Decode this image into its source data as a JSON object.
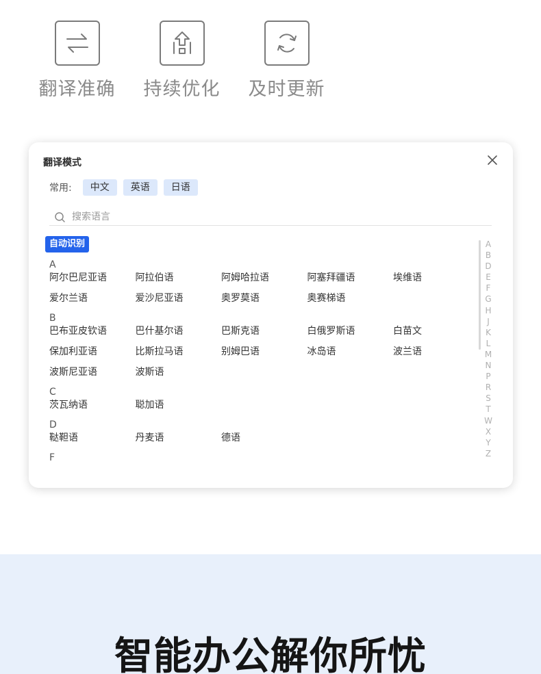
{
  "features": [
    {
      "label": "翻译准确",
      "icon": "swap-arrows-icon"
    },
    {
      "label": "持续优化",
      "icon": "upgrade-arrow-icon"
    },
    {
      "label": "及时更新",
      "icon": "refresh-icon"
    }
  ],
  "dialog": {
    "title": "翻译模式",
    "common_label": "常用:",
    "common_chips": [
      "中文",
      "英语",
      "日语"
    ],
    "search_placeholder": "搜索语言",
    "auto_detect": "自动识别",
    "groups": [
      {
        "letter": "A",
        "rows": [
          [
            "阿尔巴尼亚语",
            "阿拉伯语",
            "阿姆哈拉语",
            "阿塞拜疆语",
            "埃维语"
          ],
          [
            "爱尔兰语",
            "爱沙尼亚语",
            "奥罗莫语",
            "奥赛梯语"
          ]
        ]
      },
      {
        "letter": "B",
        "rows": [
          [
            "巴布亚皮钦语",
            "巴什基尔语",
            "巴斯克语",
            "白俄罗斯语",
            "白苗文"
          ],
          [
            "保加利亚语",
            "比斯拉马语",
            "别姆巴语",
            "冰岛语",
            "波兰语"
          ],
          [
            "波斯尼亚语",
            "波斯语"
          ]
        ]
      },
      {
        "letter": "C",
        "rows": [
          [
            "茨瓦纳语",
            "聪加语"
          ]
        ]
      },
      {
        "letter": "D",
        "rows": [
          [
            "鞑靼语",
            "丹麦语",
            "德语"
          ]
        ]
      },
      {
        "letter": "F",
        "rows": []
      }
    ],
    "index_letters": [
      "A",
      "B",
      "D",
      "E",
      "F",
      "G",
      "H",
      "J",
      "K",
      "L",
      "M",
      "N",
      "P",
      "R",
      "S",
      "T",
      "W",
      "X",
      "Y",
      "Z"
    ]
  },
  "banner": {
    "slogan": "智能办公解你所忧"
  }
}
